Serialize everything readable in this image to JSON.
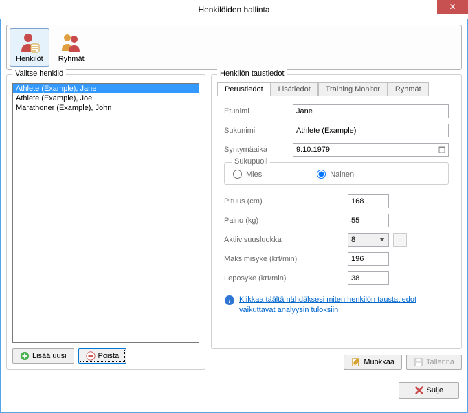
{
  "window": {
    "title": "Henkilöiden hallinta",
    "close": "✕"
  },
  "toolbar": {
    "persons": "Henkilöt",
    "groups": "Ryhmät"
  },
  "left": {
    "legend": "Valitse henkilö",
    "items": [
      "Athlete (Example), Jane",
      "Athlete (Example), Joe",
      "Marathoner (Example), John"
    ],
    "add": "Lisää uusi",
    "remove": "Poista"
  },
  "right": {
    "legend": "Henkilön taustiedot",
    "tabs": [
      "Perustiedot",
      "Lisätiedot",
      "Training Monitor",
      "Ryhmät"
    ],
    "fields": {
      "firstname_label": "Etunimi",
      "firstname": "Jane",
      "lastname_label": "Sukunimi",
      "lastname": "Athlete (Example)",
      "dob_label": "Syntymäaika",
      "dob": "9.10.1979",
      "gender_legend": "Sukupuoli",
      "male": "Mies",
      "female": "Nainen",
      "height_label": "Pituus (cm)",
      "height": "168",
      "weight_label": "Paino (kg)",
      "weight": "55",
      "activity_label": "Aktiivisuusluokka",
      "activity": "8",
      "maxhr_label": "Maksimisyke (krt/min)",
      "maxhr": "196",
      "resthr_label": "Leposyke (krt/min)",
      "resthr": "38"
    },
    "info_link": "Klikkaa täältä nähdäksesi miten henkilön taustatiedot vaikuttavat analyysin tuloksiin",
    "edit": "Muokkaa",
    "save": "Tallenna"
  },
  "footer": {
    "close": "Sulje"
  }
}
